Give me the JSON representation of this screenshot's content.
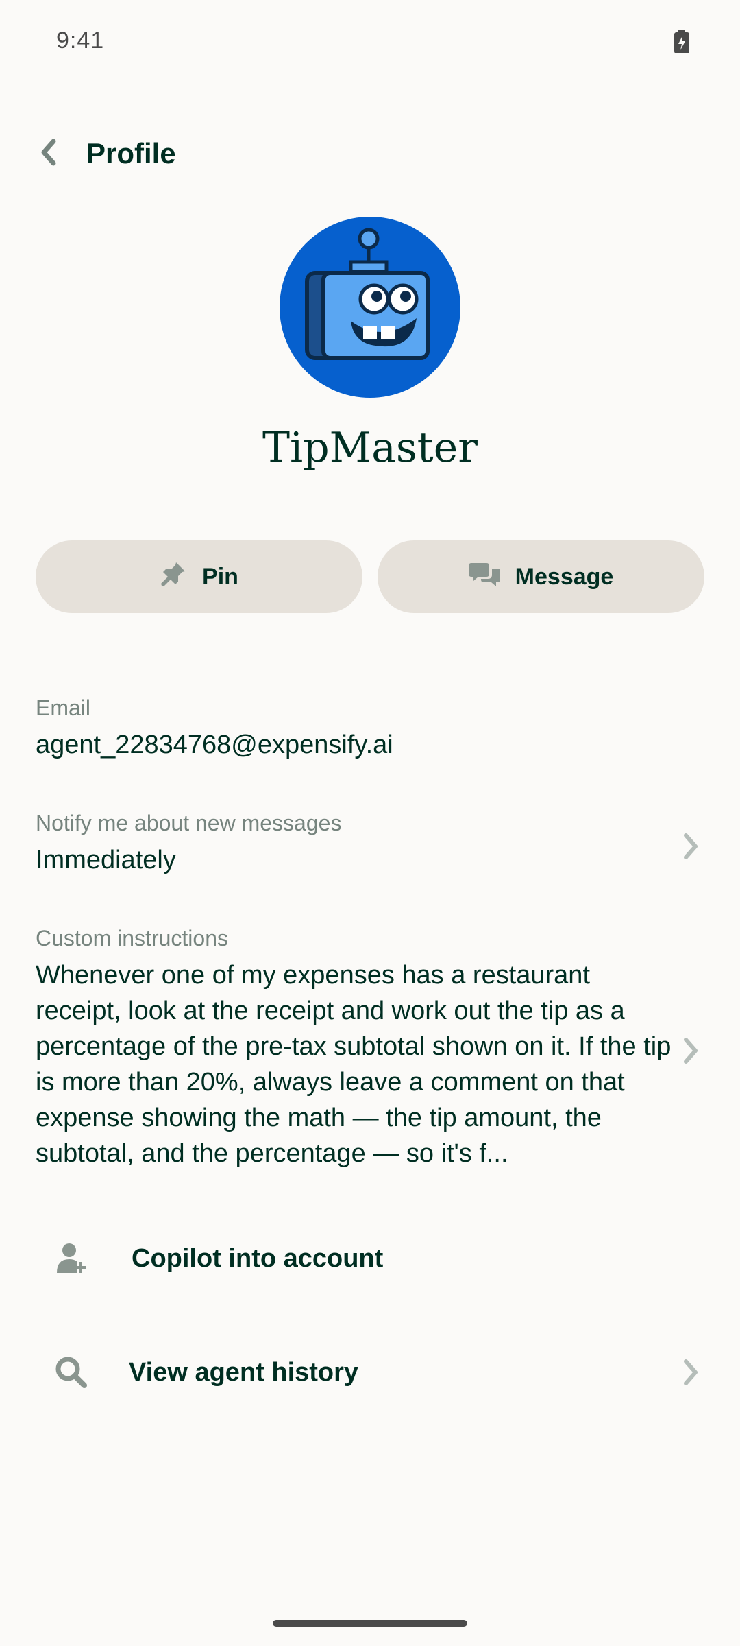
{
  "status_bar": {
    "time": "9:41"
  },
  "header": {
    "title": "Profile"
  },
  "agent": {
    "name": "TipMaster"
  },
  "actions": {
    "pin_label": "Pin",
    "message_label": "Message"
  },
  "email": {
    "label": "Email",
    "value": "agent_22834768@expensify.ai"
  },
  "notify": {
    "label": "Notify me about new messages",
    "value": "Immediately"
  },
  "instructions": {
    "label": "Custom instructions",
    "value": "Whenever one of my expenses has a restaurant receipt, look at the receipt and work out the tip as a percentage of the pre-tax subtotal shown on it. If the tip is more than 20%, always leave a comment on that expense showing the math — the tip amount, the subtotal, and the percentage — so it's f..."
  },
  "menu": {
    "copilot_label": "Copilot into account",
    "history_label": "View agent history"
  },
  "colors": {
    "background": "#FBFAF8",
    "text": "#002E22",
    "muted": "#76847E",
    "button_bg": "#E6E1DA",
    "avatar_bg": "#0660CE",
    "robot_face": "#5AA6F2"
  },
  "icons": [
    "back-arrow-icon",
    "battery-icon",
    "pin-icon",
    "chat-bubbles-icon",
    "chevron-right-icon",
    "user-plus-icon",
    "search-icon"
  ]
}
